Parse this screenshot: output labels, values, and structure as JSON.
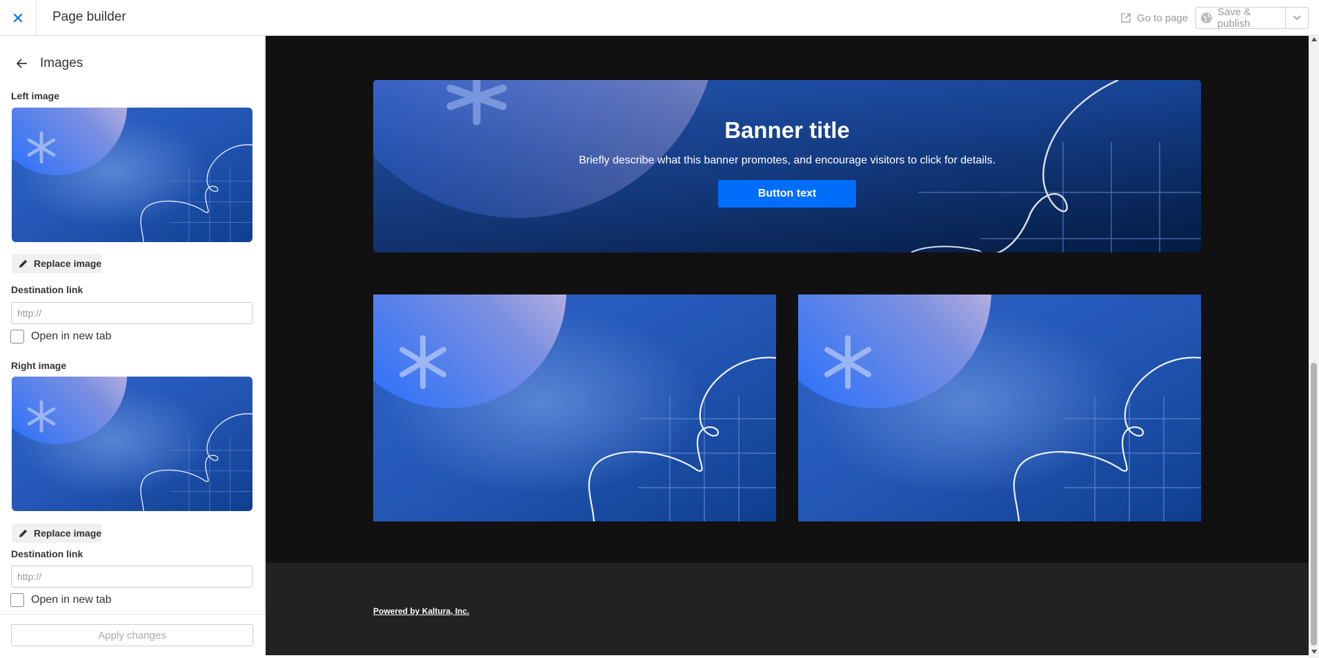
{
  "topbar": {
    "title": "Page builder",
    "close_icon": "close-icon",
    "goto_page_label": "Go to page",
    "goto_page_icon": "external-link-icon",
    "save_publish_label": "Save & publish",
    "save_publish_icon": "globe-icon",
    "dropdown_icon": "chevron-down-icon"
  },
  "panel": {
    "title": "Images",
    "back_icon": "arrow-left-icon",
    "left": {
      "label": "Left image",
      "replace_label": "Replace image",
      "destination_label": "Destination link",
      "destination_value": "",
      "destination_placeholder": "http://",
      "new_tab_label": "Open in new tab",
      "new_tab_checked": false
    },
    "right": {
      "label": "Right image",
      "replace_label": "Replace image",
      "destination_label": "Destination link",
      "destination_value": "",
      "destination_placeholder": "http://",
      "new_tab_label": "Open in new tab",
      "new_tab_checked": false
    },
    "apply_label": "Apply changes"
  },
  "preview": {
    "banner": {
      "title": "Banner title",
      "description": "Briefly describe what this banner promotes, and encourage visitors to click for details.",
      "button_label": "Button text"
    },
    "footer": {
      "powered_by": "Powered by Kaltura, Inc."
    }
  },
  "colors": {
    "accent": "#006efa",
    "close_icon": "#006efa",
    "preview_bg": "#111111",
    "footer_bg": "#222222",
    "image_blue": "#1a4fb0"
  }
}
